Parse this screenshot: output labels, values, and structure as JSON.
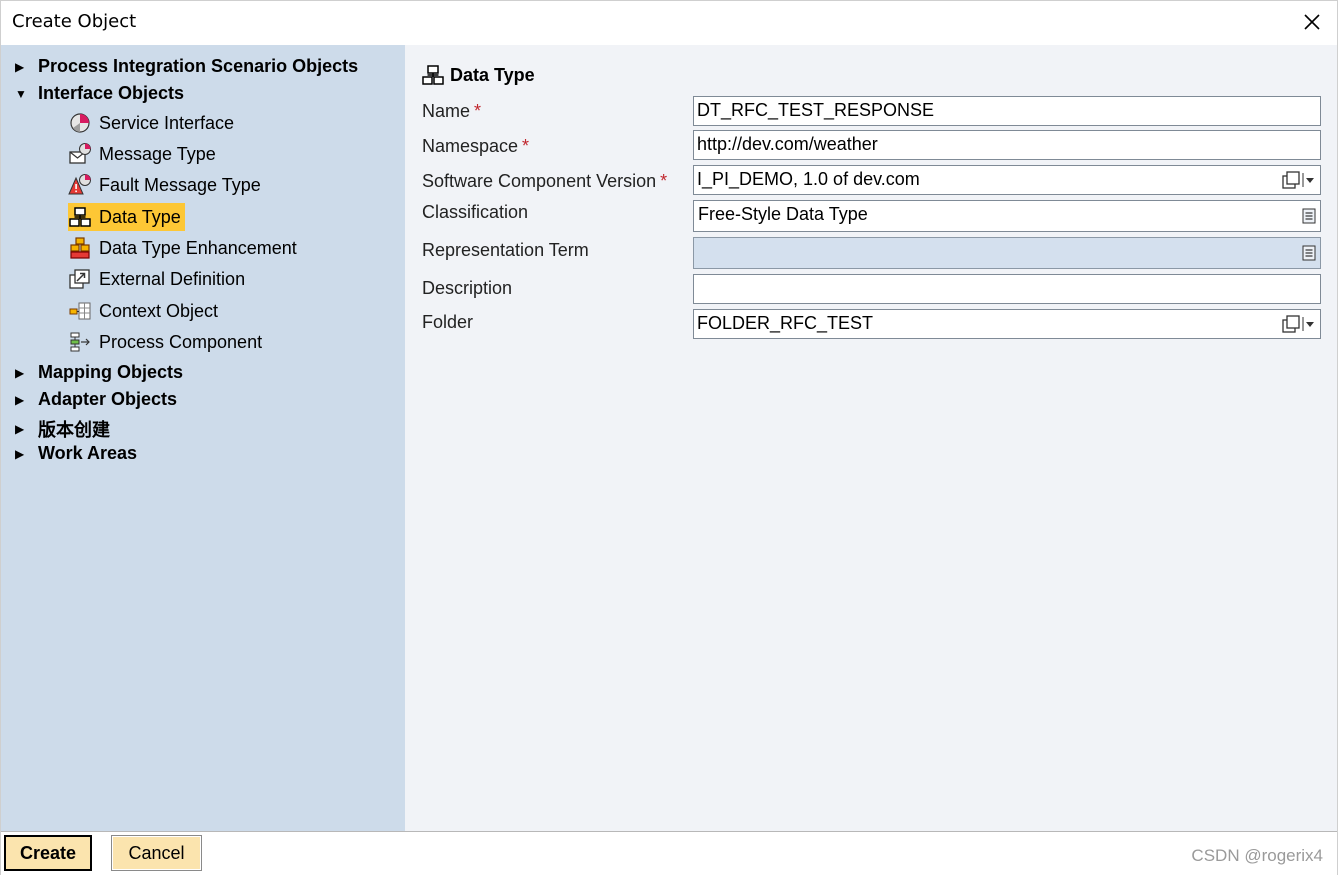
{
  "window": {
    "title": "Create Object"
  },
  "tree": {
    "top_items": [
      {
        "label": "Process Integration Scenario Objects",
        "expanded": false
      },
      {
        "label": "Interface Objects",
        "expanded": true
      },
      {
        "label": "Mapping Objects",
        "expanded": false
      },
      {
        "label": "Adapter Objects",
        "expanded": false
      },
      {
        "label": "版本创建",
        "expanded": false
      },
      {
        "label": "Work Areas",
        "expanded": false
      }
    ],
    "interface_children": [
      {
        "label": "Service Interface",
        "icon": "service-interface-icon"
      },
      {
        "label": "Message Type",
        "icon": "message-type-icon"
      },
      {
        "label": "Fault Message Type",
        "icon": "fault-message-type-icon"
      },
      {
        "label": "Data Type",
        "icon": "data-type-icon",
        "selected": true
      },
      {
        "label": "Data Type Enhancement",
        "icon": "data-type-enhancement-icon"
      },
      {
        "label": "External Definition",
        "icon": "external-definition-icon"
      },
      {
        "label": "Context Object",
        "icon": "context-object-icon"
      },
      {
        "label": "Process Component",
        "icon": "process-component-icon"
      }
    ]
  },
  "form": {
    "section_title": "Data Type",
    "required_marker": "*",
    "fields": {
      "name": {
        "label": "Name",
        "value": "DT_RFC_TEST_RESPONSE"
      },
      "namespace": {
        "label": "Namespace",
        "value": "http://dev.com/weather"
      },
      "swcv": {
        "label": "Software Component Version",
        "value": "I_PI_DEMO, 1.0 of dev.com"
      },
      "classification": {
        "label": "Classification",
        "value": "Free-Style Data Type"
      },
      "representation_term": {
        "label": "Representation Term",
        "value": ""
      },
      "description": {
        "label": "Description",
        "value": ""
      },
      "folder": {
        "label": "Folder",
        "value": "FOLDER_RFC_TEST"
      }
    }
  },
  "buttons": {
    "create": "Create",
    "cancel": "Cancel"
  },
  "watermark": "CSDN @rogerix4",
  "colors": {
    "left_pane": "#cddbea",
    "right_pane": "#f1f3f7",
    "selected": "#fdc735",
    "button": "#fbe4ae",
    "required": "#c0262d"
  }
}
